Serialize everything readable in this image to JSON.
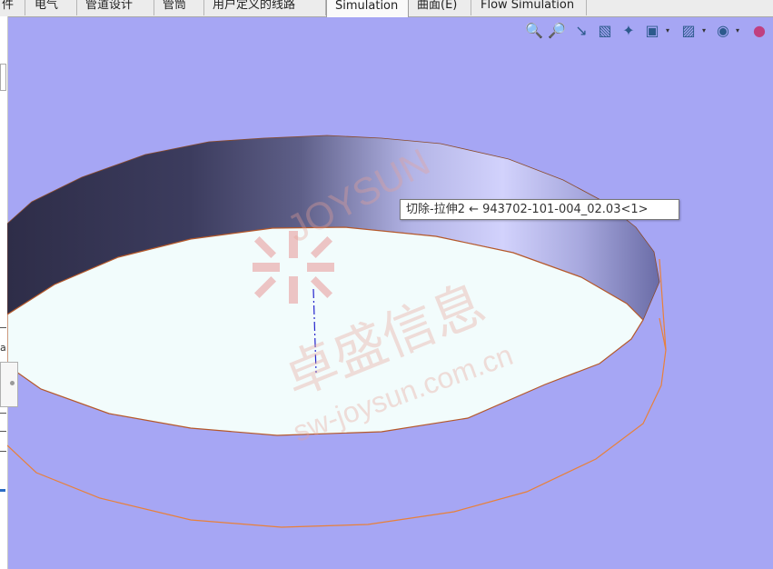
{
  "tabs": [
    {
      "label": "件",
      "active": false
    },
    {
      "label": "电气",
      "active": false
    },
    {
      "label": "管道设计",
      "active": false
    },
    {
      "label": "管筒",
      "active": false
    },
    {
      "label": "用户定义的线路",
      "active": false
    },
    {
      "label": "Simulation",
      "active": true
    },
    {
      "label": "曲面(E)",
      "active": false
    },
    {
      "label": "Flow Simulation",
      "active": false
    }
  ],
  "view_toolbar": [
    {
      "icon": "zoom-to-fit-icon"
    },
    {
      "icon": "zoom-to-area-icon"
    },
    {
      "icon": "previous-view-icon"
    },
    {
      "icon": "section-view-icon"
    },
    {
      "icon": "dynamic-annotation-icon"
    },
    {
      "icon": "view-orientation-icon"
    },
    {
      "icon": "display-style-icon"
    },
    {
      "icon": "hide-show-items-icon"
    },
    {
      "icon": "edit-appearance-icon"
    }
  ],
  "tooltip": {
    "text": "切除-拉伸2 ← 943702-101-004_02.03<1>"
  },
  "watermark": {
    "brand": "JOYSUN",
    "chinese": "卓盛信息",
    "url": "sw-joysun.com.cn"
  },
  "left_panel": {
    "fragment_letter": "a"
  },
  "colors": {
    "viewport_background": "#a6a6f4",
    "edge_highlight": "#e8803a",
    "inner_face": "#f2fcfc",
    "axis_line": "#2222cc"
  }
}
